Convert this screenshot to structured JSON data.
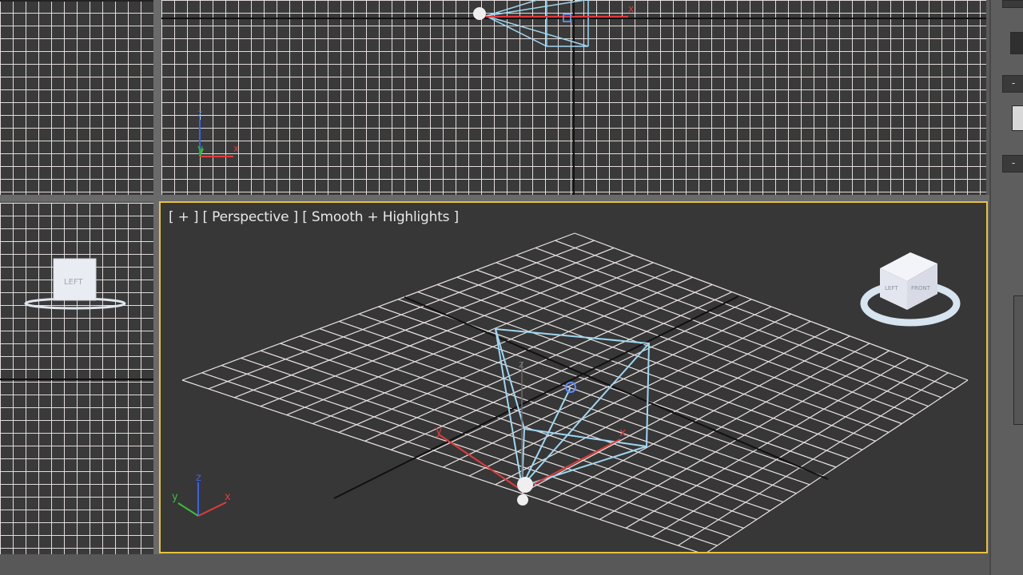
{
  "viewports": {
    "perspective": {
      "label": "[ + ] [ Perspective ] [ Smooth + Highlights ]",
      "active_border_color": "#e8c33d",
      "background_color": "#373737"
    },
    "top": {
      "grid_color": "#ece4e4"
    },
    "front": {
      "grid_color": "#ece4e4"
    },
    "left": {
      "viewcube_label": "LEFT"
    }
  },
  "gizmo": {
    "x_label": "x",
    "y_label": "y",
    "z_label": "z",
    "x_color": "#e23b3b",
    "y_color": "#37c13a",
    "z_color": "#3b63e6"
  },
  "camera": {
    "wire_color": "#9fd7f2"
  },
  "viewcube": {
    "front_label": "FRONT",
    "left_label": "LEFT"
  },
  "right_panel": {
    "collapse_1": "-",
    "collapse_2": "-"
  }
}
